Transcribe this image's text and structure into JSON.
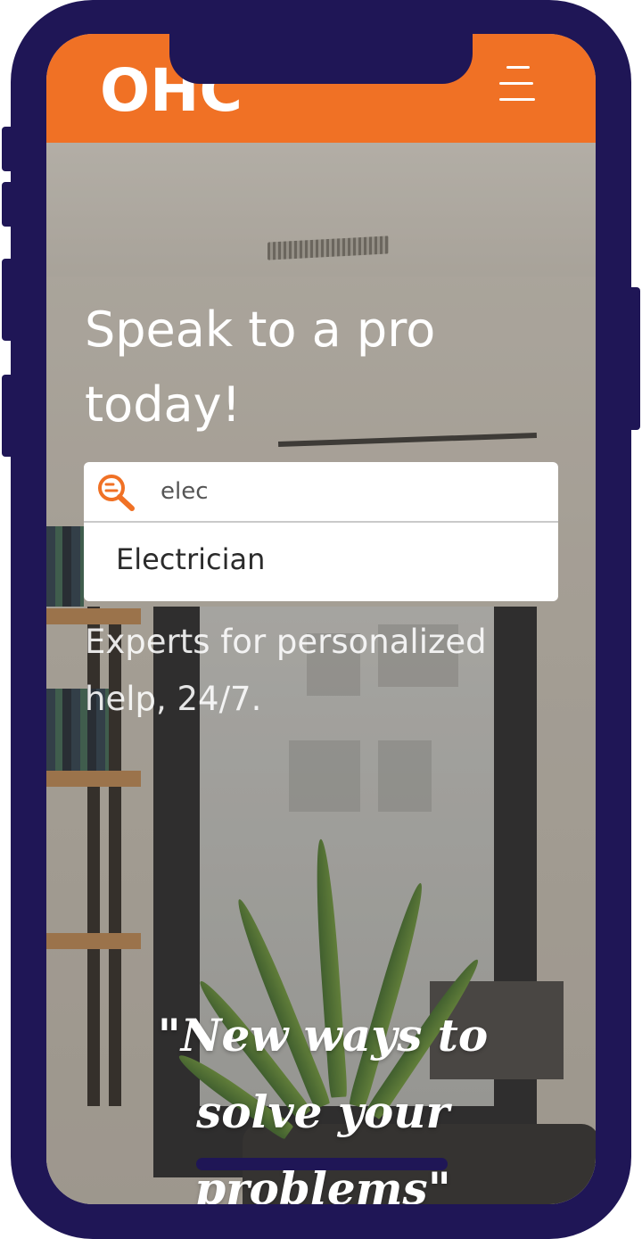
{
  "header": {
    "logo_text": "OHC",
    "menu_icon": "hamburger-icon"
  },
  "hero": {
    "title": "Speak to a pro today!",
    "subtitle": "Experts for personalized help, 24/7."
  },
  "search": {
    "icon": "search-icon",
    "value": "elec",
    "suggestions": [
      "Electrician"
    ]
  },
  "quote": {
    "text": "\"New ways to solve your problems\""
  },
  "colors": {
    "accent": "#f07125",
    "frame": "#1f1656"
  }
}
